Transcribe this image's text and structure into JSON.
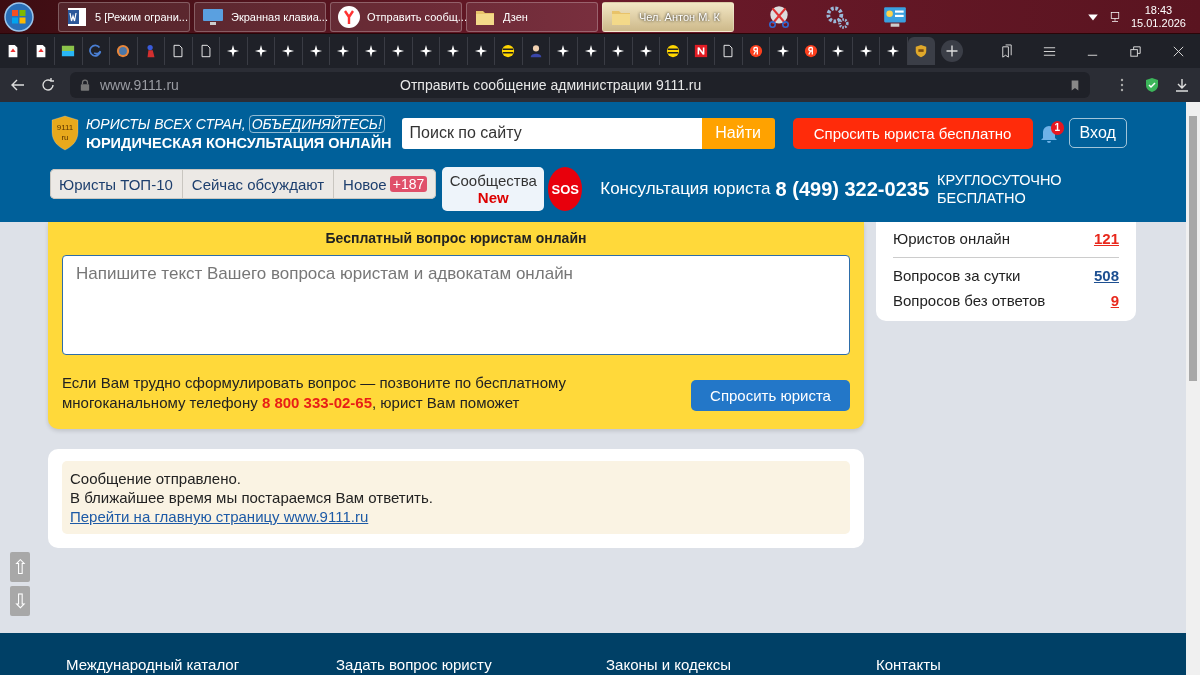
{
  "taskbar": {
    "tasks": [
      {
        "label": "5 [Режим ограни...",
        "kind": "word",
        "selected": false
      },
      {
        "label": "Экранная клавиа...",
        "kind": "keyboard",
        "selected": false
      },
      {
        "label": "Отправить сообщ...",
        "kind": "browser",
        "selected": false
      },
      {
        "label": "Дзен",
        "kind": "folder",
        "selected": false
      },
      {
        "label": "Чел. Антон М. К",
        "kind": "folder",
        "selected": true
      }
    ],
    "time": "18:43",
    "date": "15.01.2026"
  },
  "browser": {
    "tabs": [
      {
        "kind": "pdf",
        "selected": false
      },
      {
        "kind": "pdf",
        "selected": false
      },
      {
        "kind": "tile",
        "selected": false
      },
      {
        "kind": "edge",
        "selected": false
      },
      {
        "kind": "avatar",
        "selected": false
      },
      {
        "kind": "figure",
        "selected": false
      },
      {
        "kind": "doc",
        "selected": false
      },
      {
        "kind": "doc",
        "selected": false
      },
      {
        "kind": "star",
        "selected": false
      },
      {
        "kind": "star",
        "selected": false
      },
      {
        "kind": "star",
        "selected": false
      },
      {
        "kind": "star",
        "selected": false
      },
      {
        "kind": "star",
        "selected": false
      },
      {
        "kind": "star",
        "selected": false
      },
      {
        "kind": "star",
        "selected": false
      },
      {
        "kind": "star",
        "selected": false
      },
      {
        "kind": "star",
        "selected": false
      },
      {
        "kind": "star",
        "selected": false
      },
      {
        "kind": "bee",
        "selected": false
      },
      {
        "kind": "person",
        "selected": false
      },
      {
        "kind": "star",
        "selected": false
      },
      {
        "kind": "star",
        "selected": false
      },
      {
        "kind": "star",
        "selected": false
      },
      {
        "kind": "star",
        "selected": false
      },
      {
        "kind": "bee",
        "selected": false
      },
      {
        "kind": "red",
        "selected": false
      },
      {
        "kind": "doc",
        "selected": false
      },
      {
        "kind": "ya",
        "selected": false
      },
      {
        "kind": "star",
        "selected": false
      },
      {
        "kind": "ya",
        "selected": false
      },
      {
        "kind": "star",
        "selected": false
      },
      {
        "kind": "star",
        "selected": false
      },
      {
        "kind": "star",
        "selected": false
      },
      {
        "kind": "shield",
        "selected": true
      }
    ],
    "address": "www.9111.ru",
    "page_title": "Отправить сообщение администрации 9111.ru"
  },
  "header": {
    "logo_mark": [
      "9111",
      "ru"
    ],
    "slogan": "ЮРИСТЫ ВСЕХ СТРАН,",
    "slogan_box": "ОБЪЕДИНЯЙТЕСЬ!",
    "subtitle": "ЮРИДИЧЕСКАЯ КОНСУЛЬТАЦИЯ ОНЛАЙН",
    "search": {
      "placeholder": "Поиск по сайту",
      "button": "Найти"
    },
    "ask_button": "Спросить юриста бесплатно",
    "notifications": "1",
    "login": "Вход",
    "nav": [
      {
        "label": "Юристы ТОП-10"
      },
      {
        "label": "Сейчас обсуждают"
      },
      {
        "label": "Новое",
        "badge": "+187"
      }
    ],
    "communities": [
      "Сообщества",
      "New"
    ],
    "sos": "SOS",
    "phone_label": "Консультация юриста",
    "phone": "8 (499) 322-0235",
    "phone_note": "КРУГЛОСУТОЧНО БЕСПЛАТНО"
  },
  "question": {
    "title": "Бесплатный вопрос юристам онлайн",
    "placeholder": "Напишите текст Вашего вопроса юристам и адвокатам онлайн",
    "note": "Если Вам трудно сформулировать вопрос — позвоните по бесплатному многоканальному телефону **8 800 333-02-65**, юрист Вам поможет",
    "button": "Спросить юриста"
  },
  "stats": [
    {
      "label": "Юристов онлайн",
      "value": "121",
      "color": "#e8281c"
    },
    {
      "label": "Вопросов за сутки",
      "value": "508",
      "color": "#1d4f91"
    },
    {
      "label": "Вопросов без ответов",
      "value": "9",
      "color": "#e8281c"
    }
  ],
  "message": {
    "lines": [
      "Сообщение отправлено.",
      "В ближайшее время мы постараемся Вам ответить."
    ],
    "link": "Перейти на главную страницу www.9111.ru"
  },
  "scroll_buttons": [
    "⇧",
    "⇩"
  ],
  "footer": [
    "Международный каталог",
    "Задать вопрос юристу",
    "Законы и кодексы",
    "Контакты"
  ]
}
